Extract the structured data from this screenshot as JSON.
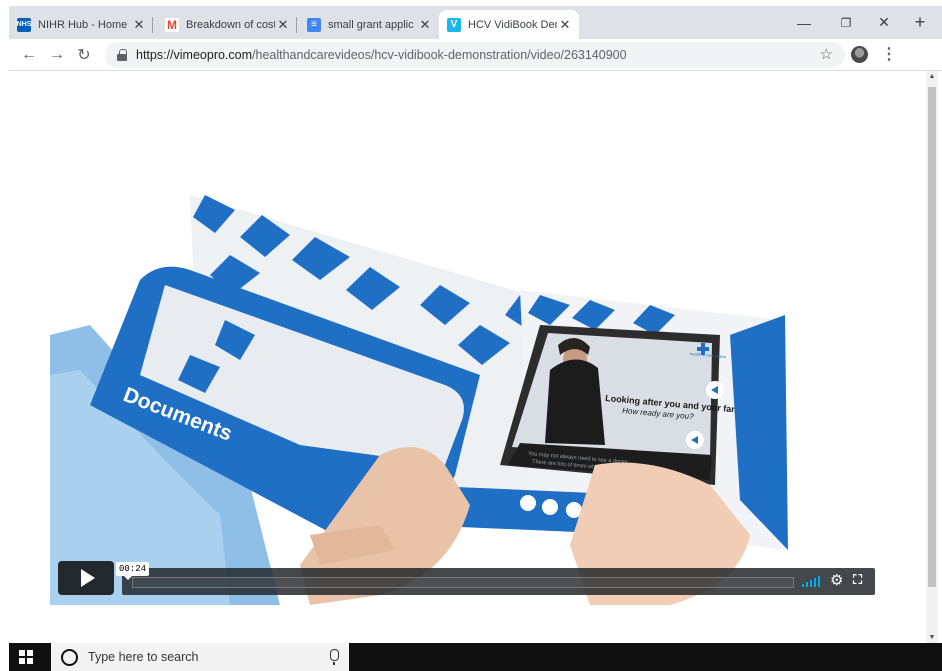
{
  "browser": {
    "tabs": [
      {
        "title": "NIHR Hub - Home",
        "favicon": "nhs-icon",
        "favicon_text": "NHS",
        "favicon_color": "#005eb8",
        "active": false
      },
      {
        "title": "Breakdown of cost",
        "favicon": "gmail-icon",
        "favicon_text": "M",
        "favicon_color": "#ea4335",
        "active": false
      },
      {
        "title": "small grant applic",
        "favicon": "docs-icon",
        "favicon_text": "≡",
        "favicon_color": "#4285f4",
        "active": false
      },
      {
        "title": "HCV VidiBook Dem",
        "favicon": "vimeo-icon",
        "favicon_text": "V",
        "favicon_color": "#1ab7ea",
        "active": true
      }
    ],
    "new_tab_label": "+",
    "window_controls": {
      "minimize": "—",
      "restore": "❐",
      "close": "✕"
    },
    "address": {
      "host": "https://vimeopro.com",
      "path": "/healthandcarevideos/hcv-vidibook-demonstration/video/263140900"
    }
  },
  "video": {
    "pocket_label": "Documents",
    "screen_title": "Looking after you and your family",
    "screen_subtitle": "How ready are you?",
    "screen_caption_1": "You may not always need to see a doctor.",
    "screen_caption_2": "There are lots of times when you",
    "logo_text": "health & care videos",
    "player": {
      "timecode": "00:24",
      "accent_color": "#00adef"
    }
  },
  "taskbar": {
    "search_placeholder": "Type here to search"
  }
}
